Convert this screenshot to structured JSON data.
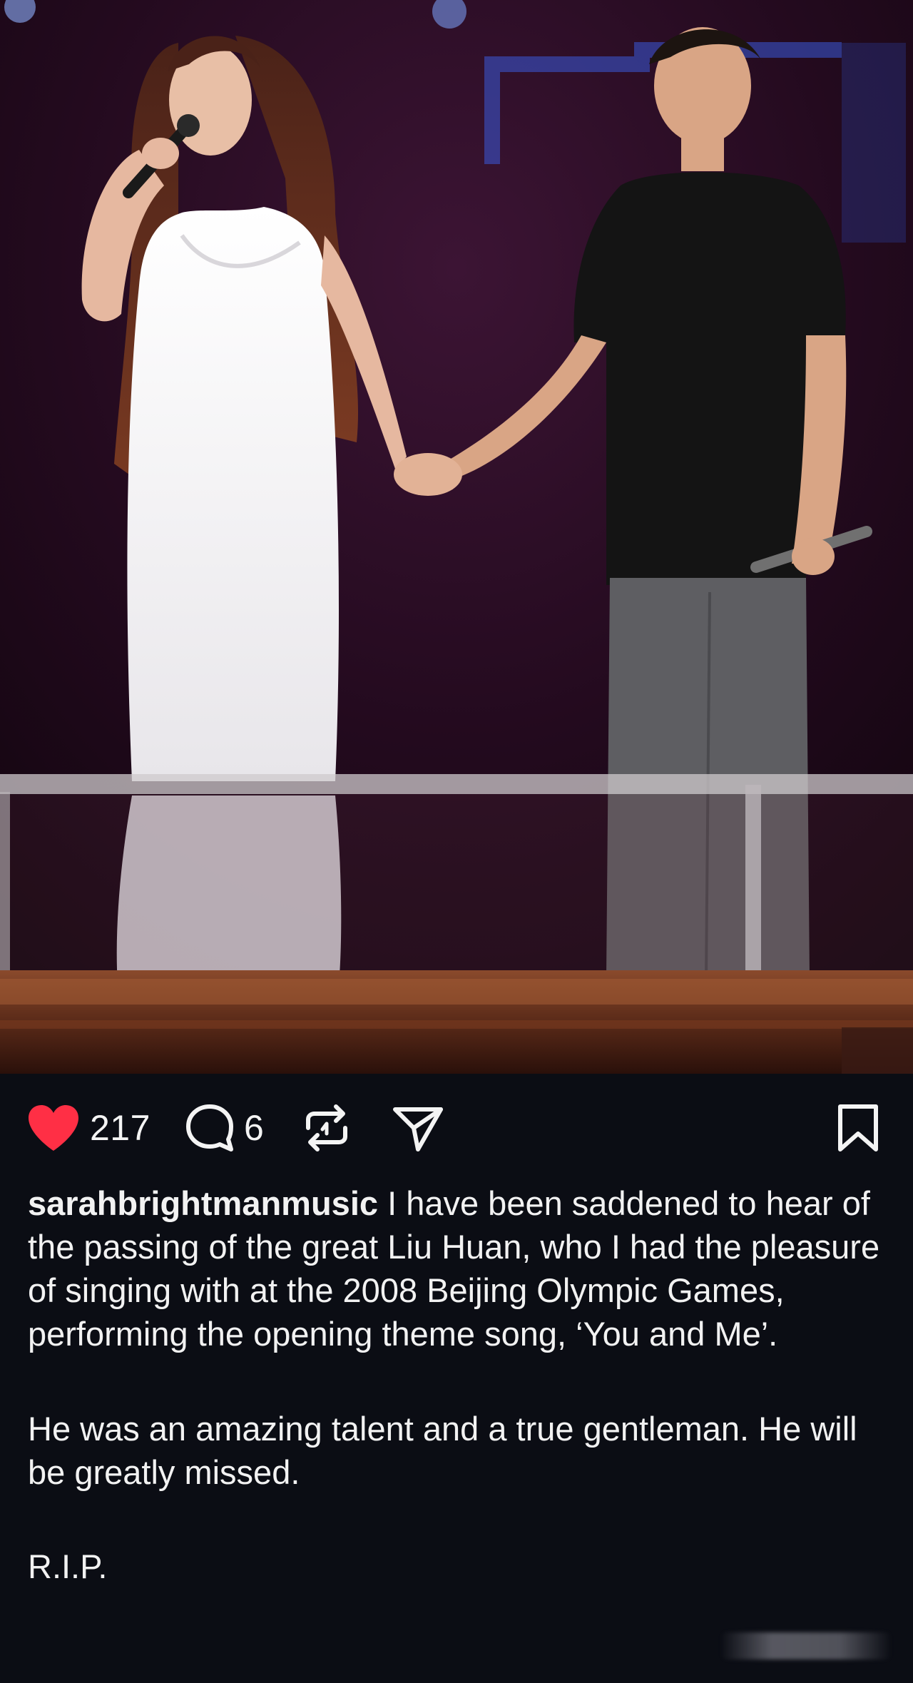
{
  "post": {
    "image": {
      "alt_semantic": "two-performers-holding-hands-photo"
    },
    "actions": {
      "likes": "217",
      "comments": "6",
      "like_color": "#ff2f45"
    },
    "caption": {
      "username": "sarahbrightmanmusic",
      "paragraph_1": "I have been saddened to hear of the passing of the great Liu Huan, who I had the pleasure of singing with at the 2008 Beijing Olympic Games, performing the opening theme song, ‘You and Me’.",
      "paragraph_2": "He was an amazing talent and a true gentleman. He will be greatly missed.",
      "paragraph_3": "R.I.P."
    },
    "icons": {
      "like": "heart-icon",
      "comment": "comment-icon",
      "repost": "repost-icon",
      "share": "send-icon",
      "save": "bookmark-icon"
    }
  }
}
